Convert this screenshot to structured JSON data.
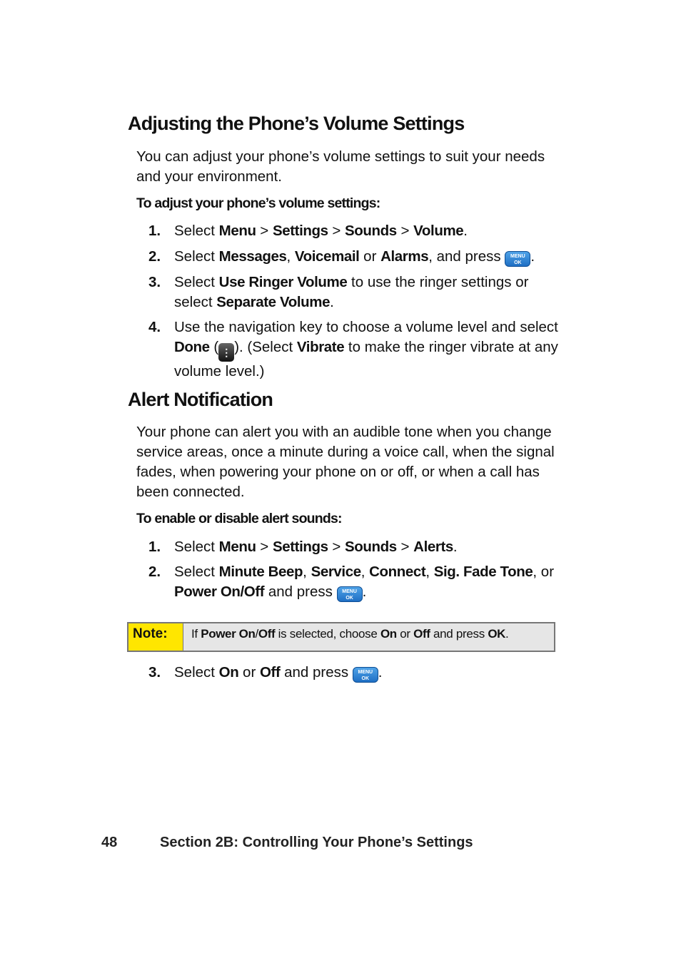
{
  "section1": {
    "title": "Adjusting the Phone’s Volume Settings",
    "intro": "You can adjust your phone’s volume settings to suit your needs and your environment.",
    "subheading": "To adjust your phone’s volume settings:",
    "steps": [
      {
        "num": "1.",
        "segments": [
          {
            "t": "Select "
          },
          {
            "t": "Menu",
            "b": true
          },
          {
            "t": " > "
          },
          {
            "t": "Settings",
            "b": true
          },
          {
            "t": " > "
          },
          {
            "t": "Sounds",
            "b": true
          },
          {
            "t": " > "
          },
          {
            "t": "Volume",
            "b": true
          },
          {
            "t": "."
          }
        ]
      },
      {
        "num": "2.",
        "segments": [
          {
            "t": "Select "
          },
          {
            "t": "Messages",
            "b": true
          },
          {
            "t": ", "
          },
          {
            "t": "Voicemail",
            "b": true
          },
          {
            "t": " or "
          },
          {
            "t": "Alarms",
            "b": true
          },
          {
            "t": ", and press "
          },
          {
            "icon": "menu-ok-key"
          },
          {
            "t": "."
          }
        ]
      },
      {
        "num": "3.",
        "segments": [
          {
            "t": "Select "
          },
          {
            "t": "Use Ringer Volume",
            "b": true
          },
          {
            "t": " to use the ringer settings or select "
          },
          {
            "t": "Separate Volume",
            "b": true
          },
          {
            "t": "."
          }
        ]
      },
      {
        "num": "4.",
        "segments": [
          {
            "t": "Use the navigation key to choose a volume level and select "
          },
          {
            "t": "Done",
            "b": true
          },
          {
            "t": " ("
          },
          {
            "icon": "done-softkey"
          },
          {
            "t": "). (Select "
          },
          {
            "t": "Vibrate",
            "b": true
          },
          {
            "t": " to make the ringer vibrate at any volume level.)"
          }
        ]
      }
    ]
  },
  "section2": {
    "title": "Alert Notification",
    "intro": "Your phone can alert you with an audible tone when you change service areas, once a minute during a voice call, when the signal fades, when powering your phone on or off, or when a call has been connected.",
    "subheading": "To enable or disable alert sounds:",
    "steps": [
      {
        "num": "1.",
        "segments": [
          {
            "t": "Select "
          },
          {
            "t": "Menu",
            "b": true
          },
          {
            "t": " > "
          },
          {
            "t": "Settings",
            "b": true
          },
          {
            "t": " > "
          },
          {
            "t": "Sounds",
            "b": true
          },
          {
            "t": " > "
          },
          {
            "t": "Alerts",
            "b": true
          },
          {
            "t": "."
          }
        ]
      },
      {
        "num": "2.",
        "segments": [
          {
            "t": "Select "
          },
          {
            "t": "Minute Beep",
            "b": true
          },
          {
            "t": ", "
          },
          {
            "t": "Service",
            "b": true
          },
          {
            "t": ", "
          },
          {
            "t": "Connect",
            "b": true
          },
          {
            "t": ", "
          },
          {
            "t": "Sig. Fade Tone",
            "b": true
          },
          {
            "t": ", or "
          },
          {
            "t": "Power On/Off",
            "b": true
          },
          {
            "t": " and press "
          },
          {
            "icon": "menu-ok-key"
          },
          {
            "t": "."
          }
        ]
      }
    ],
    "note": {
      "label": "Note:",
      "segments": [
        {
          "t": "If "
        },
        {
          "t": "Power On",
          "b": true
        },
        {
          "t": "/"
        },
        {
          "t": "Off",
          "b": true
        },
        {
          "t": " is selected, choose "
        },
        {
          "t": "On",
          "b": true
        },
        {
          "t": " or "
        },
        {
          "t": "Off",
          "b": true
        },
        {
          "t": " and press "
        },
        {
          "t": "OK",
          "b": true
        },
        {
          "t": "."
        }
      ]
    },
    "steps_after": [
      {
        "num": "3.",
        "segments": [
          {
            "t": "Select "
          },
          {
            "t": "On",
            "b": true
          },
          {
            "t": " or "
          },
          {
            "t": "Off",
            "b": true
          },
          {
            "t": " and press "
          },
          {
            "icon": "menu-ok-key"
          },
          {
            "t": "."
          }
        ]
      }
    ]
  },
  "icons": {
    "menu_ok_top": "MENU",
    "menu_ok_bottom": "OK",
    "done_glyph": "⋮"
  },
  "colors": {
    "note_label_bg": "#ffe600",
    "note_bg": "#e6e6e6",
    "menu_key": "#2a7fd4"
  },
  "footer": {
    "page_number": "48",
    "section": "Section 2B: Controlling Your Phone’s Settings"
  }
}
